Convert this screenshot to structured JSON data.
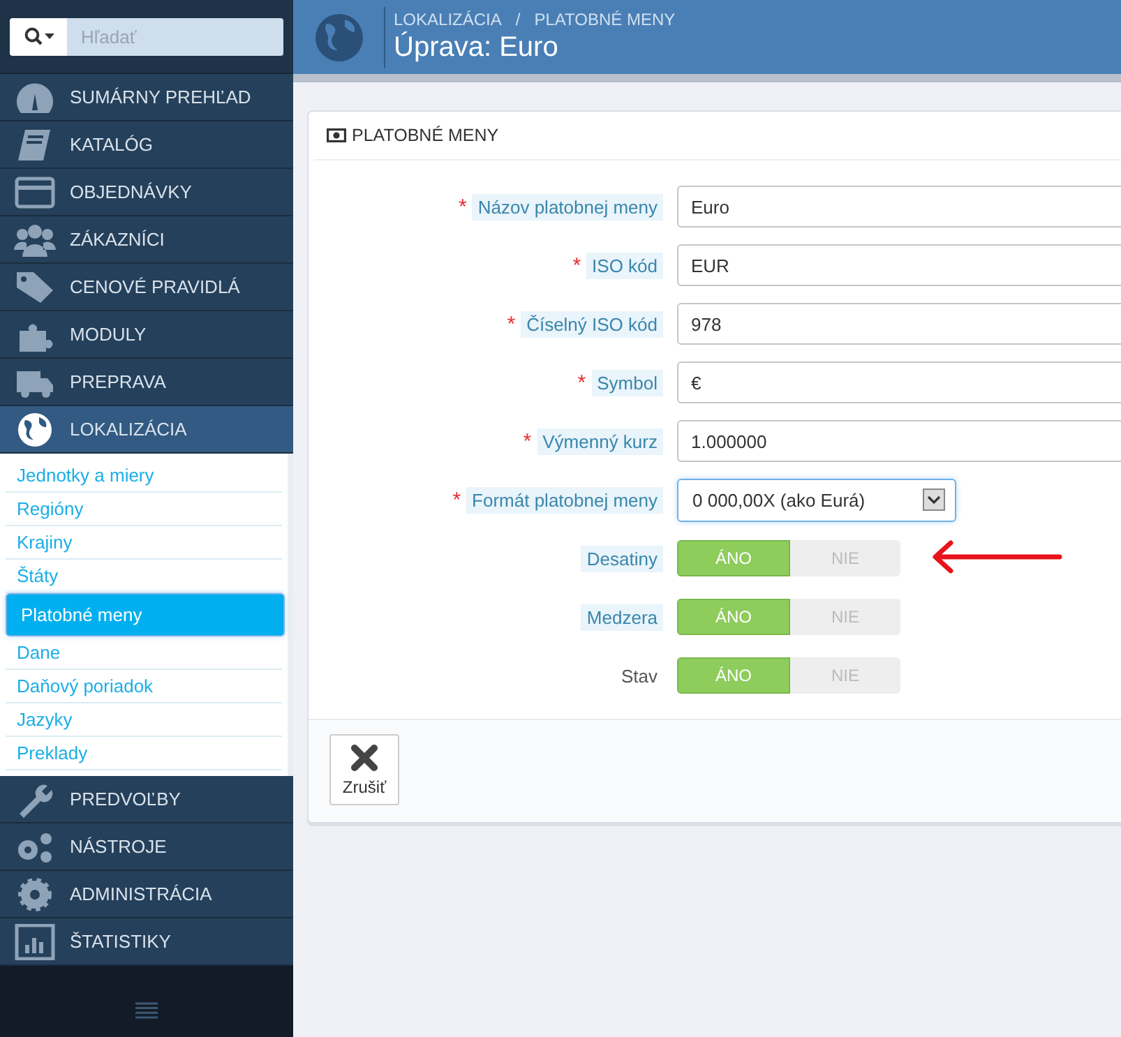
{
  "search": {
    "placeholder": "Hľadať"
  },
  "sidebar": {
    "items": [
      {
        "label": "SUMÁRNY PREHĽAD",
        "active": false
      },
      {
        "label": "KATALÓG",
        "active": false
      },
      {
        "label": "OBJEDNÁVKY",
        "active": false
      },
      {
        "label": "ZÁKAZNÍCI",
        "active": false
      },
      {
        "label": "CENOVÉ PRAVIDLÁ",
        "active": false
      },
      {
        "label": "MODULY",
        "active": false
      },
      {
        "label": "PREPRAVA",
        "active": false
      },
      {
        "label": "LOKALIZÁCIA",
        "active": true,
        "children": [
          {
            "label": "Jednotky a miery",
            "selected": false
          },
          {
            "label": "Regióny",
            "selected": false
          },
          {
            "label": "Krajiny",
            "selected": false
          },
          {
            "label": "Štáty",
            "selected": false
          },
          {
            "label": "Platobné meny",
            "selected": true
          },
          {
            "label": "Dane",
            "selected": false
          },
          {
            "label": "Daňový poriadok",
            "selected": false
          },
          {
            "label": "Jazyky",
            "selected": false
          },
          {
            "label": "Preklady",
            "selected": false
          }
        ]
      },
      {
        "label": "PREDVOĽBY",
        "active": false
      },
      {
        "label": "NÁSTROJE",
        "active": false
      },
      {
        "label": "ADMINISTRÁCIA",
        "active": false
      },
      {
        "label": "ŠTATISTIKY",
        "active": false
      }
    ]
  },
  "header": {
    "breadcrumb": [
      "LOKALIZÁCIA",
      "PLATOBNÉ MENY"
    ],
    "separator": "/",
    "title": "Úprava: Euro"
  },
  "panel": {
    "title": "PLATOBNÉ MENY",
    "fields": [
      {
        "kind": "text",
        "label": "Názov platobnej meny",
        "required_mark": "*",
        "hint": true,
        "value": "Euro"
      },
      {
        "kind": "text",
        "label": "ISO kód",
        "required_mark": "*",
        "hint": true,
        "value": "EUR"
      },
      {
        "kind": "text",
        "label": "Číselný ISO kód",
        "required_mark": "*",
        "hint": true,
        "value": "978"
      },
      {
        "kind": "text",
        "label": "Symbol",
        "required_mark": "*",
        "hint": true,
        "value": "€"
      },
      {
        "kind": "text",
        "label": "Výmenný kurz",
        "required_mark": "*",
        "hint": true,
        "value": "1.000000"
      },
      {
        "kind": "select",
        "label": "Formát platobnej meny",
        "required_mark": "*",
        "hint": true,
        "value": "0 000,00X (ako Eurá)"
      },
      {
        "kind": "switch",
        "label": "Desatiny",
        "hint": true,
        "options": [
          {
            "label": "ÁNO",
            "selected": true
          },
          {
            "label": "NIE",
            "selected": false
          }
        ]
      },
      {
        "kind": "switch",
        "label": "Medzera",
        "hint": true,
        "options": [
          {
            "label": "ÁNO",
            "selected": true
          },
          {
            "label": "NIE",
            "selected": false
          }
        ]
      },
      {
        "kind": "switch",
        "label": "Stav",
        "hint": false,
        "options": [
          {
            "label": "ÁNO",
            "selected": true
          },
          {
            "label": "NIE",
            "selected": false
          }
        ]
      }
    ],
    "buttons": [
      {
        "label": "Zrušiť"
      }
    ]
  }
}
